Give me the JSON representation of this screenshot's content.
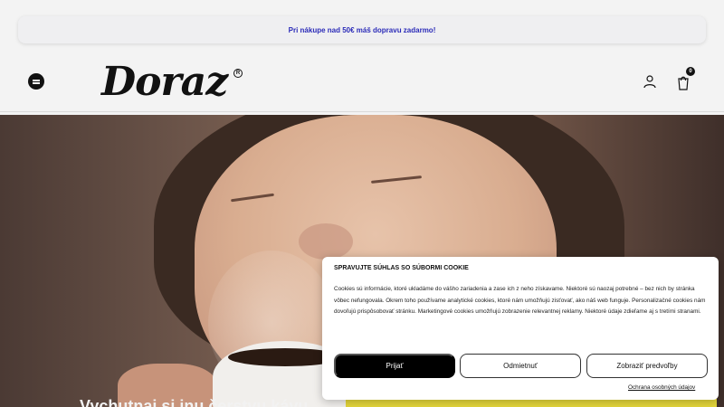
{
  "promo": {
    "text": "Pri nákupe nad 50€ máš dopravu zadarmo!"
  },
  "header": {
    "logo_text": "Doraz",
    "logo_reg": "R",
    "cart_count": "0"
  },
  "hero": {
    "headline_visible": "Vychutnaj si inu čerstvu kávu"
  },
  "cookie_banner": {
    "title": "SPRAVUJTE SÚHLAS SO SÚBORMI COOKIE",
    "body": "Cookies sú informácie, ktoré ukladáme do vášho zariadenia a zase ich z neho získavame. Niektoré sú naozaj potrebné – bez nich by stránka vôbec nefungovala. Okrem toho používame analytické cookies, ktoré nám umožňujú zisťovať, ako náš web funguje. Personalizačné cookies nám dovoľujú prispôsobovať stránku. Marketingové cookies umožňujú zobrazenie relevantnej reklamy. Niektoré údaje zdieľame aj s tretími stranami.",
    "accept_label": "Prijať",
    "deny_label": "Odmietnuť",
    "prefs_label": "Zobraziť predvoľby",
    "privacy_link": "Ochrana osobných údajov"
  }
}
